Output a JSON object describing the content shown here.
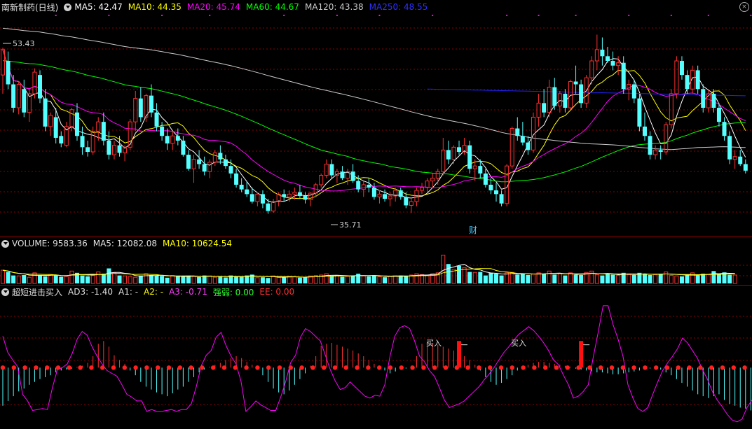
{
  "price_header": {
    "stock_title": "南新制药(日线)",
    "ma5": "MA5: 42.47",
    "ma10": "MA10: 44.35",
    "ma20": "MA20: 45.74",
    "ma60": "MA60: 44.67",
    "ma120": "MA120: 43.38",
    "ma250": "MA250: 48.55"
  },
  "price_annotations": {
    "high_label": "53.43",
    "low_label": "35.71",
    "finance_marker": "财"
  },
  "volume_header": {
    "volume": "VOLUME: 9583.36",
    "ma5": "MA5: 12082.08",
    "ma10": "MA10: 10624.54"
  },
  "indicator_header": {
    "name": "超短进击买入",
    "ad3": "AD3: -1.40",
    "a1": "A1: -",
    "a2": "A2: -",
    "a3": "A3: -0.71",
    "strength": "强弱: 0.00",
    "ee": "EE: 0.00"
  },
  "indicator_annotations": {
    "buy_label_1": "买入",
    "buy_label_2": "买入"
  },
  "colors": {
    "background": "#000000",
    "up_candle": "#ff3030",
    "down_candle": "#54ffff",
    "ma5": "#ffffff",
    "ma10": "#ffff00",
    "ma20": "#ff00ff",
    "ma60": "#00ff00",
    "ma120": "#cccccc",
    "ma250": "#2020ff",
    "grid": "#8b0000"
  },
  "chart_data": {
    "type": "candlestick",
    "y_range": [
      33.5,
      57.0
    ],
    "candles": [
      [
        50.5,
        53.4,
        48.5,
        53.2
      ],
      [
        52.0,
        53.0,
        49.0,
        49.5
      ],
      [
        49.5,
        50.5,
        46.5,
        47.0
      ],
      [
        47.0,
        49.8,
        46.3,
        49.5
      ],
      [
        49.0,
        50.0,
        46.0,
        46.5
      ],
      [
        46.5,
        49.0,
        45.5,
        48.5
      ],
      [
        48.5,
        51.2,
        48.0,
        50.8
      ],
      [
        50.5,
        51.0,
        47.5,
        48.0
      ],
      [
        48.0,
        49.0,
        44.5,
        45.0
      ],
      [
        45.0,
        46.5,
        44.0,
        46.2
      ],
      [
        46.0,
        47.0,
        43.2,
        43.8
      ],
      [
        44.0,
        44.5,
        42.8,
        43.2
      ],
      [
        43.0,
        45.5,
        42.8,
        45.0
      ],
      [
        45.0,
        47.0,
        44.5,
        46.8
      ],
      [
        46.5,
        47.5,
        43.5,
        44.0
      ],
      [
        44.0,
        45.0,
        42.0,
        42.8
      ],
      [
        42.8,
        43.5,
        41.8,
        42.3
      ],
      [
        42.3,
        45.0,
        42.0,
        44.5
      ],
      [
        44.5,
        46.0,
        43.5,
        45.5
      ],
      [
        45.5,
        46.5,
        43.0,
        43.5
      ],
      [
        43.5,
        44.5,
        41.5,
        42.0
      ],
      [
        42.0,
        43.5,
        41.5,
        43.0
      ],
      [
        43.0,
        44.0,
        41.8,
        42.2
      ],
      [
        42.2,
        43.0,
        41.3,
        42.8
      ],
      [
        42.8,
        45.8,
        42.5,
        45.5
      ],
      [
        45.5,
        48.8,
        44.5,
        48.0
      ],
      [
        48.0,
        49.2,
        45.5,
        46.0
      ],
      [
        46.0,
        48.5,
        45.5,
        48.3
      ],
      [
        48.3,
        49.5,
        46.0,
        46.5
      ],
      [
        46.5,
        47.5,
        44.5,
        45.0
      ],
      [
        45.0,
        45.5,
        43.5,
        44.0
      ],
      [
        44.0,
        44.8,
        42.5,
        43.2
      ],
      [
        43.2,
        44.5,
        42.5,
        44.0
      ],
      [
        44.0,
        44.8,
        43.0,
        43.5
      ],
      [
        43.5,
        44.0,
        41.8,
        42.0
      ],
      [
        42.0,
        42.5,
        40.3,
        40.5
      ],
      [
        40.5,
        42.0,
        39.0,
        41.5
      ],
      [
        41.5,
        42.5,
        40.5,
        41.0
      ],
      [
        41.0,
        41.8,
        39.8,
        40.2
      ],
      [
        40.2,
        41.5,
        39.5,
        41.2
      ],
      [
        41.2,
        42.5,
        40.8,
        42.2
      ],
      [
        42.2,
        43.0,
        41.0,
        41.5
      ],
      [
        41.5,
        42.0,
        40.5,
        40.8
      ],
      [
        40.8,
        41.5,
        39.5,
        40.0
      ],
      [
        40.0,
        40.5,
        38.5,
        38.8
      ],
      [
        38.8,
        39.5,
        38.0,
        38.3
      ],
      [
        38.3,
        39.2,
        37.5,
        37.8
      ],
      [
        37.8,
        38.5,
        36.8,
        37.0
      ],
      [
        37.0,
        38.0,
        36.5,
        37.8
      ],
      [
        37.8,
        38.2,
        36.3,
        36.8
      ],
      [
        36.8,
        37.3,
        35.7,
        36.0
      ],
      [
        36.0,
        37.3,
        35.8,
        37.0
      ],
      [
        37.0,
        38.0,
        36.5,
        37.8
      ],
      [
        37.8,
        38.3,
        37.0,
        37.5
      ],
      [
        37.5,
        38.2,
        37.0,
        37.8
      ],
      [
        37.8,
        38.5,
        37.2,
        38.0
      ],
      [
        38.0,
        38.8,
        37.3,
        37.6
      ],
      [
        37.6,
        38.0,
        36.8,
        37.2
      ],
      [
        37.2,
        38.0,
        36.5,
        37.9
      ],
      [
        37.9,
        39.0,
        37.5,
        38.8
      ],
      [
        38.8,
        40.0,
        38.5,
        39.8
      ],
      [
        39.8,
        41.5,
        39.5,
        41.0
      ],
      [
        41.0,
        41.5,
        39.5,
        39.8
      ],
      [
        39.8,
        40.5,
        39.0,
        40.2
      ],
      [
        40.2,
        40.8,
        39.3,
        39.5
      ],
      [
        39.5,
        40.5,
        38.8,
        40.2
      ],
      [
        40.2,
        41.0,
        39.0,
        39.2
      ],
      [
        39.2,
        39.8,
        38.0,
        38.3
      ],
      [
        38.3,
        39.2,
        37.5,
        38.8
      ],
      [
        38.8,
        39.5,
        38.0,
        38.5
      ],
      [
        38.5,
        39.0,
        37.2,
        37.5
      ],
      [
        37.5,
        38.2,
        36.8,
        37.8
      ],
      [
        37.8,
        38.3,
        37.0,
        37.3
      ],
      [
        37.3,
        38.0,
        36.5,
        37.6
      ],
      [
        37.6,
        38.5,
        37.0,
        38.2
      ],
      [
        38.2,
        38.5,
        37.2,
        37.5
      ],
      [
        37.5,
        38.0,
        36.3,
        36.6
      ],
      [
        36.6,
        37.3,
        35.8,
        37.0
      ],
      [
        37.0,
        38.5,
        36.5,
        38.2
      ],
      [
        38.2,
        39.0,
        37.8,
        38.5
      ],
      [
        38.5,
        39.5,
        38.0,
        39.2
      ],
      [
        39.2,
        40.0,
        38.5,
        39.5
      ],
      [
        39.5,
        40.5,
        38.8,
        40.2
      ],
      [
        40.2,
        43.8,
        39.8,
        42.5
      ],
      [
        42.5,
        43.5,
        41.0,
        41.5
      ],
      [
        41.5,
        43.0,
        41.0,
        42.8
      ],
      [
        42.8,
        43.5,
        42.0,
        42.3
      ],
      [
        42.3,
        43.8,
        42.0,
        43.0
      ],
      [
        43.0,
        43.5,
        40.0,
        40.5
      ],
      [
        40.5,
        41.5,
        39.2,
        40.8
      ],
      [
        40.8,
        41.5,
        39.5,
        40.0
      ],
      [
        40.0,
        40.5,
        38.5,
        38.8
      ],
      [
        38.8,
        39.5,
        37.8,
        38.2
      ],
      [
        38.2,
        39.0,
        37.0,
        37.8
      ],
      [
        37.8,
        38.2,
        36.5,
        36.8
      ],
      [
        36.8,
        41.0,
        36.5,
        40.8
      ],
      [
        40.8,
        45.0,
        40.5,
        44.8
      ],
      [
        44.8,
        46.0,
        43.5,
        44.0
      ],
      [
        44.0,
        45.5,
        43.0,
        43.3
      ],
      [
        43.3,
        44.0,
        42.0,
        42.5
      ],
      [
        42.5,
        46.5,
        42.2,
        46.0
      ],
      [
        46.0,
        48.5,
        45.0,
        47.5
      ],
      [
        47.5,
        49.0,
        46.0,
        46.5
      ],
      [
        46.5,
        50.0,
        46.0,
        49.2
      ],
      [
        49.2,
        50.2,
        46.8,
        47.2
      ],
      [
        47.2,
        48.8,
        46.5,
        48.5
      ],
      [
        48.5,
        49.0,
        46.5,
        47.0
      ],
      [
        47.0,
        50.0,
        46.8,
        49.8
      ],
      [
        49.8,
        51.5,
        48.5,
        49.5
      ],
      [
        49.5,
        50.0,
        47.0,
        47.5
      ],
      [
        47.5,
        50.5,
        47.0,
        50.2
      ],
      [
        50.2,
        52.5,
        49.5,
        52.0
      ],
      [
        52.0,
        54.8,
        51.0,
        53.2
      ],
      [
        53.2,
        54.5,
        51.5,
        52.5
      ],
      [
        52.5,
        53.5,
        51.8,
        52.0
      ],
      [
        52.0,
        53.0,
        51.0,
        51.5
      ],
      [
        51.5,
        52.5,
        50.5,
        51.8
      ],
      [
        51.8,
        52.5,
        48.5,
        49.0
      ],
      [
        49.0,
        50.0,
        47.8,
        49.5
      ],
      [
        49.5,
        50.0,
        47.5,
        48.0
      ],
      [
        48.0,
        48.5,
        44.5,
        45.0
      ],
      [
        45.0,
        46.5,
        43.5,
        44.0
      ],
      [
        44.0,
        44.5,
        41.5,
        42.0
      ],
      [
        42.0,
        43.0,
        41.5,
        42.5
      ],
      [
        42.5,
        43.0,
        41.5,
        42.3
      ],
      [
        42.3,
        45.5,
        42.0,
        45.2
      ],
      [
        45.2,
        49.0,
        44.8,
        48.5
      ],
      [
        48.5,
        52.5,
        48.0,
        52.0
      ],
      [
        52.0,
        52.5,
        50.0,
        50.5
      ],
      [
        50.5,
        51.0,
        48.5,
        49.0
      ],
      [
        49.0,
        51.5,
        48.5,
        51.0
      ],
      [
        51.0,
        51.5,
        48.5,
        49.0
      ],
      [
        49.0,
        49.5,
        46.5,
        47.0
      ],
      [
        47.0,
        49.0,
        46.5,
        48.5
      ],
      [
        48.5,
        49.0,
        46.5,
        47.0
      ],
      [
        47.0,
        47.5,
        45.0,
        45.5
      ],
      [
        45.5,
        46.0,
        43.5,
        44.0
      ],
      [
        44.0,
        44.5,
        41.0,
        41.5
      ],
      [
        41.5,
        42.5,
        40.5,
        41.8
      ],
      [
        41.8,
        42.5,
        40.8,
        41.0
      ],
      [
        41.0,
        41.5,
        40.0,
        40.3
      ]
    ],
    "volume": {
      "y_range": [
        0,
        38000
      ],
      "values": [
        15000,
        13000,
        9000,
        8500,
        9500,
        7000,
        12000,
        9000,
        8000,
        10000,
        9500,
        7500,
        8000,
        14000,
        12000,
        9000,
        8000,
        9000,
        13000,
        11000,
        17000,
        12000,
        9000,
        8500,
        8000,
        7000,
        9000,
        11000,
        9500,
        8800,
        8500,
        6500,
        9000,
        8000,
        7500,
        8600,
        8000,
        7200,
        9000,
        8500,
        7000,
        7500,
        6800,
        9000,
        8000,
        7500,
        9000,
        10000,
        6500,
        7000,
        6200,
        8500,
        7000,
        6800,
        8000,
        7500,
        6500,
        7200,
        8500,
        9000,
        9500,
        11000,
        8000,
        9000,
        7500,
        8000,
        9000,
        11000,
        8500,
        8000,
        9000,
        7500,
        7000,
        8000,
        8500,
        9000,
        8000,
        9500,
        11000,
        10000,
        9000,
        11000,
        12000,
        32000,
        22000,
        16000,
        20000,
        18000,
        13000,
        12500,
        13000,
        9000,
        12000,
        11000,
        9000,
        12000,
        12500,
        10000,
        11000,
        9500,
        10500,
        12000,
        11000,
        14000,
        10000,
        11000,
        9000,
        12000,
        10000,
        9500,
        12500,
        14000,
        10000,
        9000,
        11500,
        10000,
        9000,
        12000,
        10000,
        9500,
        12000,
        11000,
        9500,
        10000,
        10500,
        13000,
        9000,
        8500,
        8000,
        9500,
        12000,
        9000,
        11000,
        10000,
        14000,
        11000,
        12500,
        9800,
        9500
      ]
    },
    "indicator": {
      "y_range": [
        -6.3,
        7.3
      ],
      "a3_line": [
        3.3,
        1.6,
        0.8,
        0.1,
        -2.8,
        -3.5,
        -4.5,
        -4.4,
        -4.3,
        -4.4,
        -2.1,
        -0.2,
        0.0,
        0.4,
        1.5,
        3.0,
        3.8,
        3.4,
        2.2,
        1.2,
        0.4,
        -0.3,
        -0.6,
        -0.9,
        -1.8,
        -2.8,
        -3.1,
        -3.5,
        -3.5,
        -4.6,
        -4.4,
        -4.6,
        -4.6,
        -4.5,
        -4.4,
        -4.6,
        -4.4,
        -4.4,
        -3.8,
        -2.0,
        0.2,
        1.3,
        1.8,
        3.2,
        3.7,
        2.3,
        1.2,
        0.4,
        -1.4,
        -4.6,
        -4.1,
        -3.5,
        -3.9,
        -4.2,
        -4.5,
        -4.5,
        -3.1,
        -1.5,
        0.5,
        1.3,
        3.2,
        4.1,
        3.8,
        3.3,
        2.8,
        1.3,
        -0.2,
        -1.4,
        -2.3,
        -2.1,
        -1.5,
        -2.0,
        -2.5,
        -3.0,
        -3.2,
        -2.9,
        -3.0,
        -1.8,
        1.1,
        3.3,
        4.2,
        4.4,
        4.1,
        2.8,
        1.2,
        0.6,
        -0.3,
        -0.9,
        -2.1,
        -3.4,
        -4.2,
        -4.0,
        -3.8,
        -3.5,
        -3.0,
        -2.5,
        -2.0,
        -1.3,
        -0.7,
        0.0,
        0.8,
        1.6,
        2.2,
        2.9,
        3.5,
        3.9,
        4.3,
        3.9,
        3.3,
        2.6,
        1.8,
        0.8,
        0.3,
        -0.8,
        -1.8,
        -3.2,
        -3.0,
        -2.5,
        -1.8,
        1.1,
        3.7,
        6.5,
        6.5,
        4.5,
        3.0,
        1.2,
        -1.8,
        -3.2,
        -4.3,
        -4.6,
        -4.2,
        -2.8,
        -1.5,
        -0.3,
        0.5,
        1.2,
        2.0,
        3.1,
        2.6,
        1.8,
        1.0,
        -0.2,
        -1.2,
        -2.5,
        -3.4,
        -4.1,
        -4.9,
        -5.5,
        -5.7,
        -5.4,
        -4.2,
        -3.4
      ],
      "bars": [
        -4.0,
        -3.5,
        -3.0,
        -2.5,
        -2.2,
        -1.8,
        -1.5,
        -1.2,
        -1.0,
        -0.8,
        -0.5,
        -0.3,
        -0.2,
        -0.1,
        0.1,
        0.2,
        0.5,
        1.2,
        2.5,
        2.8,
        2.2,
        1.3,
        0.8,
        0.4,
        -0.3,
        -0.8,
        -1.5,
        -2.0,
        -2.3,
        -2.6,
        -2.8,
        -3.0,
        -2.7,
        -2.3,
        -2.0,
        -1.5,
        -1.0,
        -0.5,
        -0.2,
        0.1,
        0.3,
        0.5,
        0.8,
        1.0,
        1.2,
        1.0,
        0.6,
        0.3,
        0.0,
        -0.8,
        -1.5,
        -2.2,
        -2.6,
        -2.8,
        -2.4,
        -1.8,
        -1.2,
        -0.6,
        0.2,
        1.2,
        2.3,
        2.5,
        2.6,
        2.4,
        2.2,
        2.0,
        1.8,
        1.5,
        1.2,
        0.8,
        0.4,
        0.1,
        -0.3,
        -0.6,
        -0.4,
        -0.2,
        -0.1,
        0.2,
        1.2,
        2.5,
        2.8,
        2.6,
        2.4,
        2.2,
        2.0,
        1.8,
        1.5,
        1.2,
        0.8,
        0.3,
        -0.3,
        -1.0,
        -1.5,
        -1.8,
        -1.6,
        -1.2,
        -0.8,
        -0.3,
        0.1,
        0.3,
        0.5,
        0.6,
        0.6,
        0.5,
        0.4,
        0.3,
        0.2,
        0.1,
        -0.1,
        -0.2,
        -0.3,
        -0.4,
        -0.5,
        -0.5,
        -0.6,
        -0.7,
        -0.7,
        -0.6,
        -0.5,
        -0.4,
        -0.3,
        -0.2,
        -0.1,
        0.0,
        -0.2,
        -0.5,
        -0.8,
        -1.2,
        -1.6,
        -2.0,
        -2.4,
        -2.8,
        -3.0,
        -3.2,
        -3.0,
        -2.8,
        -3.4,
        -3.8,
        -4.0,
        -4.2,
        -4.3,
        -4.5,
        -4.2,
        -3.8,
        -3.5,
        -3.0,
        -2.5,
        -2.0,
        -1.6,
        -1.4
      ],
      "buy_signal_indices": [
        86,
        109
      ]
    }
  }
}
